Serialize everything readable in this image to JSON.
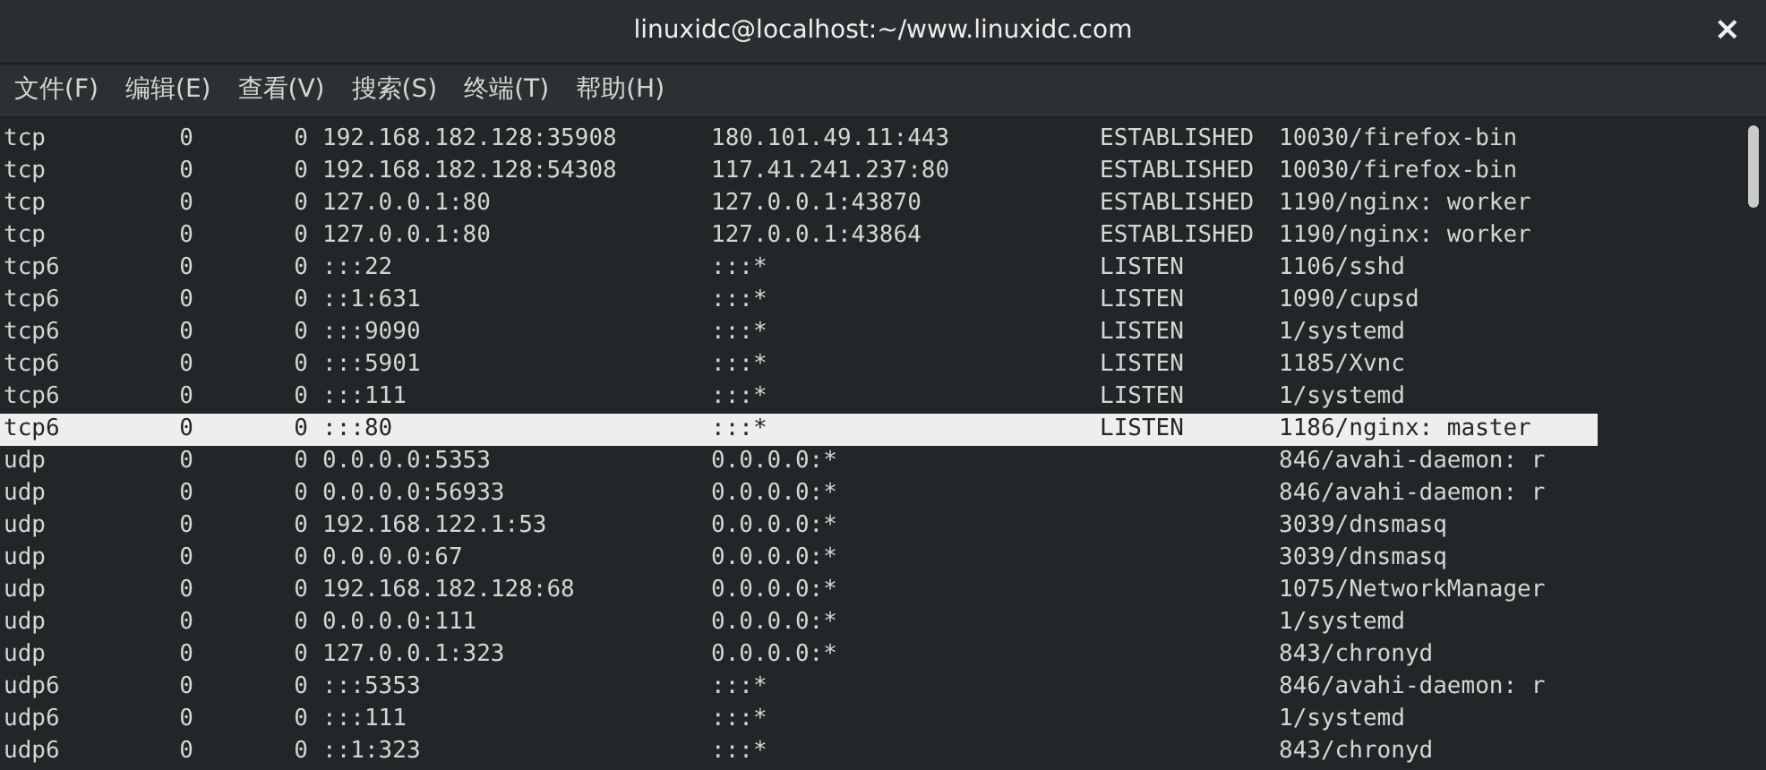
{
  "window": {
    "title": "linuxidc@localhost:~/www.linuxidc.com",
    "close": "×"
  },
  "menu": [
    "文件(F)",
    "编辑(E)",
    "查看(V)",
    "搜索(S)",
    "终端(T)",
    "帮助(H)"
  ],
  "rows": [
    {
      "proto": "tcp",
      "recv_q": "0",
      "send_q": "0",
      "local": "192.168.182.128:35908",
      "foreign": "180.101.49.11:443",
      "state": "ESTABLISHED",
      "program": "10030/firefox-bin",
      "selected": false
    },
    {
      "proto": "tcp",
      "recv_q": "0",
      "send_q": "0",
      "local": "192.168.182.128:54308",
      "foreign": "117.41.241.237:80",
      "state": "ESTABLISHED",
      "program": "10030/firefox-bin",
      "selected": false
    },
    {
      "proto": "tcp",
      "recv_q": "0",
      "send_q": "0",
      "local": "127.0.0.1:80",
      "foreign": "127.0.0.1:43870",
      "state": "ESTABLISHED",
      "program": "1190/nginx: worker",
      "selected": false
    },
    {
      "proto": "tcp",
      "recv_q": "0",
      "send_q": "0",
      "local": "127.0.0.1:80",
      "foreign": "127.0.0.1:43864",
      "state": "ESTABLISHED",
      "program": "1190/nginx: worker",
      "selected": false
    },
    {
      "proto": "tcp6",
      "recv_q": "0",
      "send_q": "0",
      "local": ":::22",
      "foreign": ":::*",
      "state": "LISTEN",
      "program": "1106/sshd",
      "selected": false
    },
    {
      "proto": "tcp6",
      "recv_q": "0",
      "send_q": "0",
      "local": "::1:631",
      "foreign": ":::*",
      "state": "LISTEN",
      "program": "1090/cupsd",
      "selected": false
    },
    {
      "proto": "tcp6",
      "recv_q": "0",
      "send_q": "0",
      "local": ":::9090",
      "foreign": ":::*",
      "state": "LISTEN",
      "program": "1/systemd",
      "selected": false
    },
    {
      "proto": "tcp6",
      "recv_q": "0",
      "send_q": "0",
      "local": ":::5901",
      "foreign": ":::*",
      "state": "LISTEN",
      "program": "1185/Xvnc",
      "selected": false
    },
    {
      "proto": "tcp6",
      "recv_q": "0",
      "send_q": "0",
      "local": ":::111",
      "foreign": ":::*",
      "state": "LISTEN",
      "program": "1/systemd",
      "selected": false
    },
    {
      "proto": "tcp6",
      "recv_q": "0",
      "send_q": "0",
      "local": ":::80",
      "foreign": ":::*",
      "state": "LISTEN",
      "program": "1186/nginx: master",
      "selected": true
    },
    {
      "proto": "udp",
      "recv_q": "0",
      "send_q": "0",
      "local": "0.0.0.0:5353",
      "foreign": "0.0.0.0:*",
      "program": "846/avahi-daemon: r",
      "selected": false
    },
    {
      "proto": "udp",
      "recv_q": "0",
      "send_q": "0",
      "local": "0.0.0.0:56933",
      "foreign": "0.0.0.0:*",
      "program": "846/avahi-daemon: r",
      "selected": false
    },
    {
      "proto": "udp",
      "recv_q": "0",
      "send_q": "0",
      "local": "192.168.122.1:53",
      "foreign": "0.0.0.0:*",
      "program": "3039/dnsmasq",
      "selected": false
    },
    {
      "proto": "udp",
      "recv_q": "0",
      "send_q": "0",
      "local": "0.0.0.0:67",
      "foreign": "0.0.0.0:*",
      "program": "3039/dnsmasq",
      "selected": false
    },
    {
      "proto": "udp",
      "recv_q": "0",
      "send_q": "0",
      "local": "192.168.182.128:68",
      "foreign": "0.0.0.0:*",
      "program": "1075/NetworkManager",
      "selected": false
    },
    {
      "proto": "udp",
      "recv_q": "0",
      "send_q": "0",
      "local": "0.0.0.0:111",
      "foreign": "0.0.0.0:*",
      "program": "1/systemd",
      "selected": false
    },
    {
      "proto": "udp",
      "recv_q": "0",
      "send_q": "0",
      "local": "127.0.0.1:323",
      "foreign": "0.0.0.0:*",
      "program": "843/chronyd",
      "selected": false
    },
    {
      "proto": "udp6",
      "recv_q": "0",
      "send_q": "0",
      "local": ":::5353",
      "foreign": ":::*",
      "program": "846/avahi-daemon: r",
      "selected": false
    },
    {
      "proto": "udp6",
      "recv_q": "0",
      "send_q": "0",
      "local": ":::111",
      "foreign": ":::*",
      "program": "1/systemd",
      "selected": false
    },
    {
      "proto": "udp6",
      "recv_q": "0",
      "send_q": "0",
      "local": "::1:323",
      "foreign": ":::*",
      "program": "843/chronyd",
      "selected": false
    }
  ]
}
